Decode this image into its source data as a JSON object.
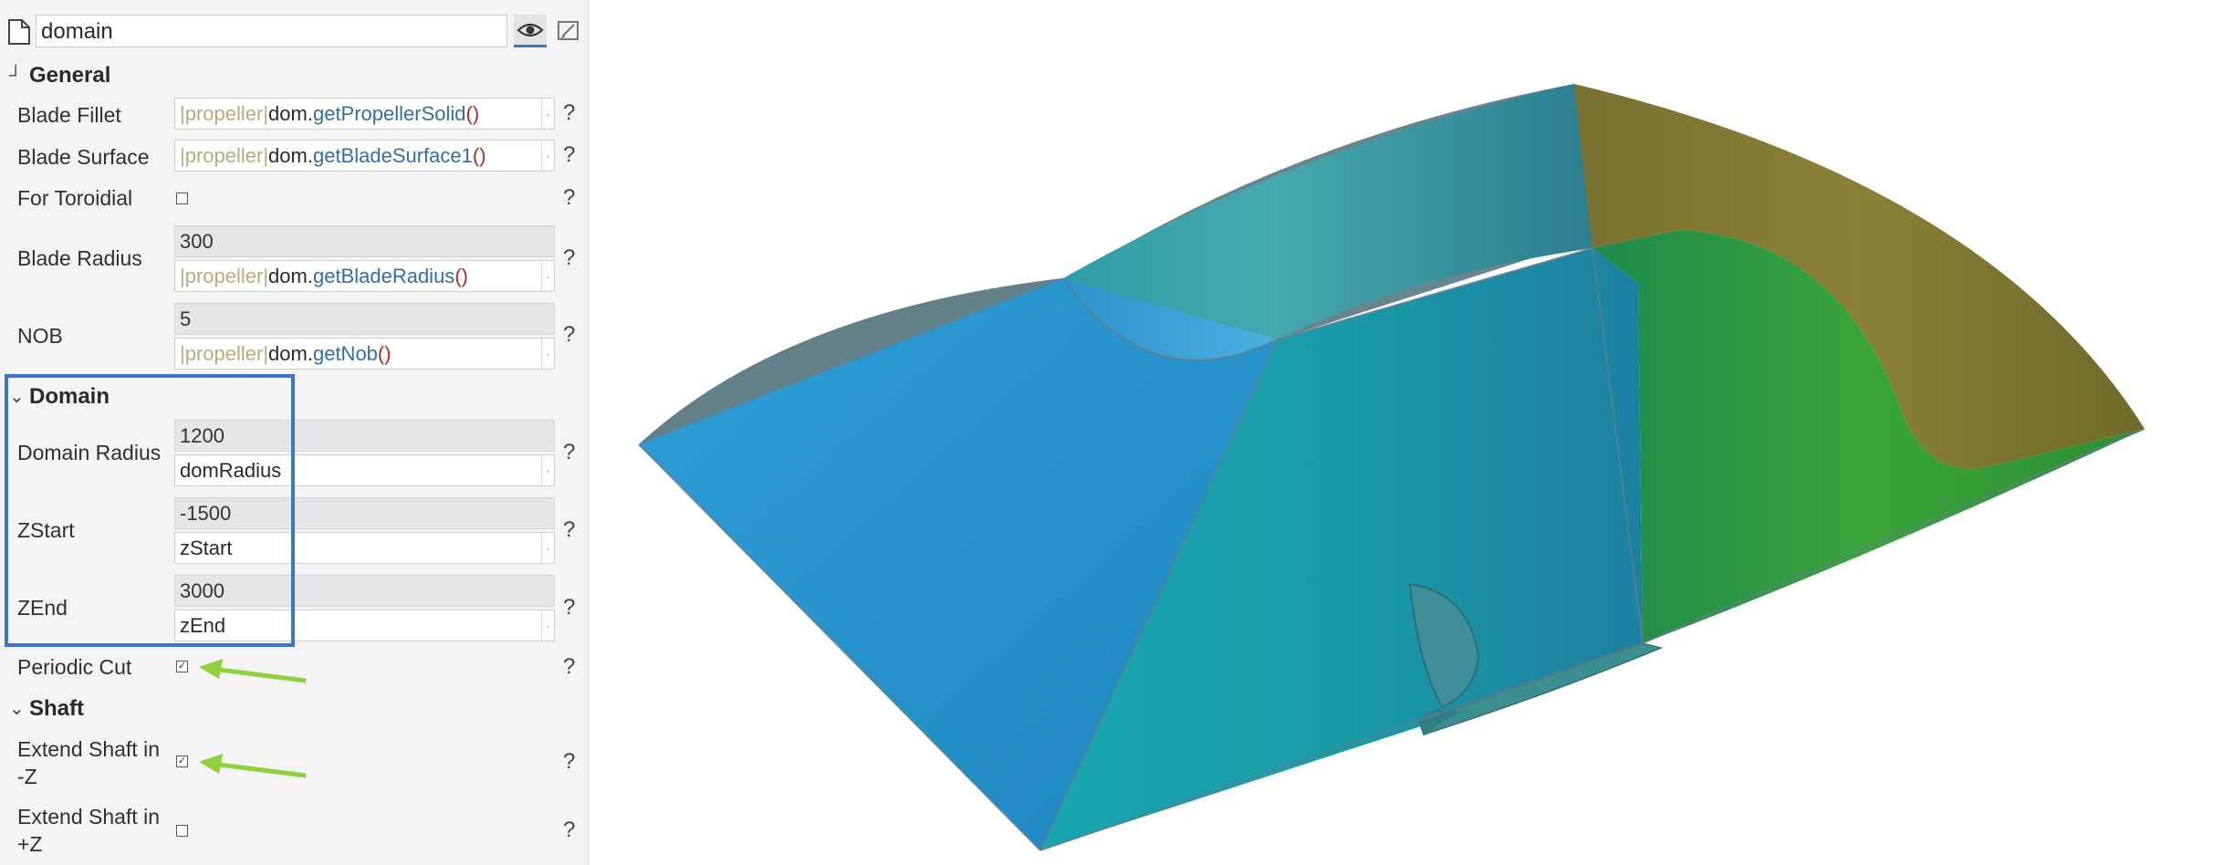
{
  "header": {
    "name_value": "domain",
    "page_icon": "page-icon",
    "view_icon": "eye-icon",
    "edit_icon": "edit-icon"
  },
  "sections": {
    "general": "General",
    "domain": "Domain",
    "shaft": "Shaft"
  },
  "general": {
    "blade_fillet": {
      "label": "Blade Fillet",
      "pipe1": "|",
      "ns": "propeller",
      "pipe2": "|",
      "obj": "dom.",
      "fn": "getPropellerSolid",
      "paren": "()"
    },
    "blade_surface": {
      "label": "Blade Surface",
      "pipe1": "|",
      "ns": "propeller",
      "pipe2": "|",
      "obj": "dom.",
      "fn": "getBladeSurface1",
      "paren": "()"
    },
    "for_toroidial": {
      "label": "For Toroidial",
      "checked": false
    },
    "blade_radius": {
      "label": "Blade Radius",
      "value": "300",
      "pipe1": "|",
      "ns": "propeller",
      "pipe2": "|",
      "obj": "dom.",
      "fn": "getBladeRadius",
      "paren": "()"
    },
    "nob": {
      "label": "NOB",
      "value": "5",
      "pipe1": "|",
      "ns": "propeller",
      "pipe2": "|",
      "obj": "dom.",
      "fn": "getNob",
      "paren": "()"
    }
  },
  "domain": {
    "domain_radius": {
      "label": "Domain Radius",
      "value": "1200",
      "expr": "domRadius"
    },
    "zstart": {
      "label": "ZStart",
      "value": "-1500",
      "expr": "zStart"
    },
    "zend": {
      "label": "ZEnd",
      "value": "3000",
      "expr": "zEnd"
    }
  },
  "periodic_cut": {
    "label": "Periodic Cut",
    "checked": true
  },
  "shaft": {
    "extend_minus": {
      "label_line1": "Extend Shaft in",
      "label_line2": "-Z",
      "checked": true
    },
    "extend_plus": {
      "label_line1": "Extend Shaft in",
      "label_line2": "+Z",
      "checked": false
    }
  },
  "help": "?",
  "dropdown_glyph": "·",
  "colors": {
    "highlight_box": "#3a78c7",
    "arrow": "#8fd13a",
    "function_token": "#2f6faa",
    "paren_token": "#c0241f",
    "pipe_token": "#b6ae7a"
  }
}
